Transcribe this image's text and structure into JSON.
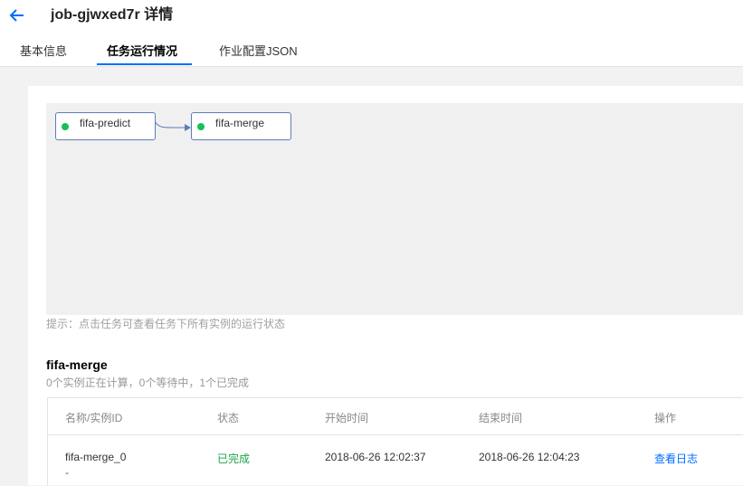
{
  "header": {
    "title": "job-gjwxed7r 详情",
    "tabs": [
      {
        "label": "基本信息"
      },
      {
        "label": "任务运行情况"
      },
      {
        "label": "作业配置JSON"
      }
    ],
    "active_tab_color": "#006eff"
  },
  "graph": {
    "nodes": [
      {
        "label": "fifa-predict",
        "status_color": "#14c05a"
      },
      {
        "label": "fifa-merge",
        "status_color": "#14c05a"
      }
    ],
    "hint": "提示：点击任务可查看任务下所有实例的运行状态"
  },
  "task": {
    "name": "fifa-merge",
    "summary": "0个实例正在计算，0个等待中，1个已完成"
  },
  "table": {
    "columns": [
      "名称/实例ID",
      "状态",
      "开始时间",
      "结束时间",
      "操作"
    ],
    "rows": [
      {
        "name": "fifa-merge_0",
        "id": "-",
        "status": "已完成",
        "start": "2018-06-26 12:02:37",
        "end": "2018-06-26 12:04:23",
        "action": "查看日志"
      }
    ]
  }
}
